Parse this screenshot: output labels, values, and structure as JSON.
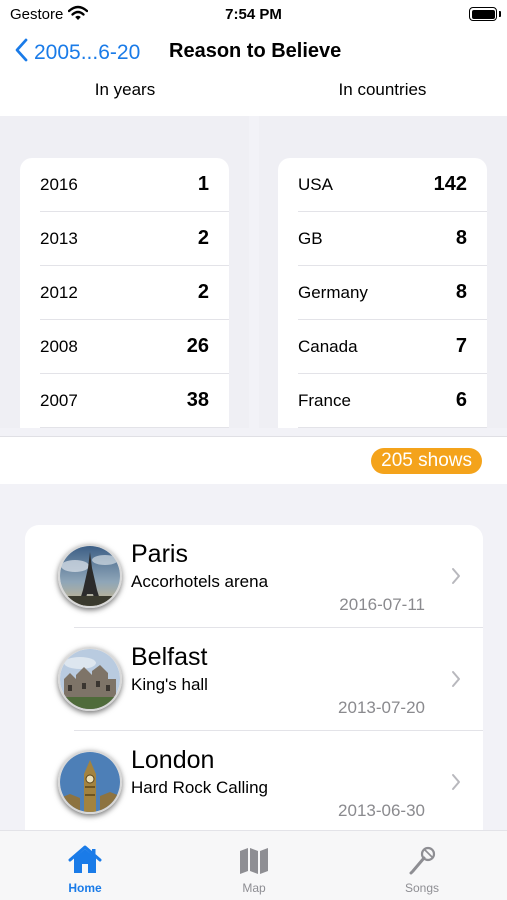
{
  "status_bar": {
    "carrier": "Gestore",
    "time": "7:54 PM"
  },
  "nav": {
    "back_label": "2005...6-20",
    "title": "Reason to Believe"
  },
  "columns": {
    "years_heading": "In years",
    "countries_heading": "In countries"
  },
  "years": [
    {
      "label": "2016",
      "value": "1"
    },
    {
      "label": "2013",
      "value": "2"
    },
    {
      "label": "2012",
      "value": "2"
    },
    {
      "label": "2008",
      "value": "26"
    },
    {
      "label": "2007",
      "value": "38"
    }
  ],
  "countries": [
    {
      "label": "USA",
      "value": "142"
    },
    {
      "label": "GB",
      "value": "8"
    },
    {
      "label": "Germany",
      "value": "8"
    },
    {
      "label": "Canada",
      "value": "7"
    },
    {
      "label": "France",
      "value": "6"
    }
  ],
  "shows_badge": "205 shows",
  "concerts": [
    {
      "city": "Paris",
      "venue": "Accorhotels arena",
      "date": "2016-07-11",
      "icon": "eiffel-tower-photo"
    },
    {
      "city": "Belfast",
      "venue": "King's hall",
      "date": "2013-07-20",
      "icon": "belfast-castle-photo"
    },
    {
      "city": "London",
      "venue": "Hard Rock Calling",
      "date": "2013-06-30",
      "icon": "big-ben-photo"
    }
  ],
  "tabs": [
    {
      "label": "Home",
      "icon": "house-icon",
      "active": true
    },
    {
      "label": "Map",
      "icon": "map-icon",
      "active": false
    },
    {
      "label": "Songs",
      "icon": "microphone-icon",
      "active": false
    }
  ],
  "colors": {
    "accent": "#1a7be8",
    "badge": "#f4a31b",
    "inactive_tab": "#8e8e93"
  }
}
